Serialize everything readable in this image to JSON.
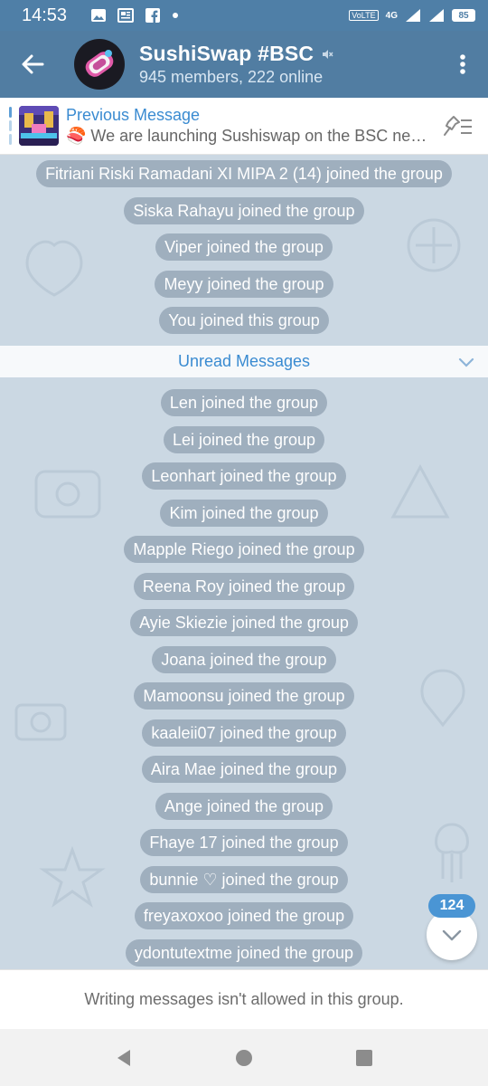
{
  "status_bar": {
    "time": "14:53",
    "network": "4G",
    "battery": "85",
    "volte": "VoLTE"
  },
  "header": {
    "title": "SushiSwap #BSC",
    "subtitle": "945 members, 222 online",
    "muted": true
  },
  "pinned": {
    "title": "Previous Message",
    "preview": "🍣 We are launching Sushiswap on the BSC net..."
  },
  "messages_before_unread": [
    "Fitriani Riski Ramadani XI MIPA 2 (14) joined the group",
    "Siska Rahayu joined the group",
    "Viper joined the group",
    "Meyy joined the group",
    "You joined this group"
  ],
  "unread_label": "Unread Messages",
  "messages_after_unread": [
    "Len joined the group",
    "Lei joined the group",
    "Leonhart joined the group",
    "Kim joined the group",
    "Mapple Riego joined the group",
    "Reena Roy joined the group",
    "Ayie Skiezie joined the group",
    "Joana joined the group",
    "Mamoonsu joined the group",
    "kaaleii07 joined the group",
    "Aira Mae joined the group",
    "Ange joined the group",
    "Fhaye 17 joined the group",
    "bunnie ♡ joined the group",
    "freyaxoxoo joined the group",
    "ydontutextme joined the group"
  ],
  "unread_count": "124",
  "bottom_text": "Writing messages isn't allowed in this group.",
  "colors": {
    "header": "#517da2",
    "status_bar": "#4f7fa7",
    "accent": "#3a8bd1",
    "chat_bg": "#cbd8e3"
  }
}
